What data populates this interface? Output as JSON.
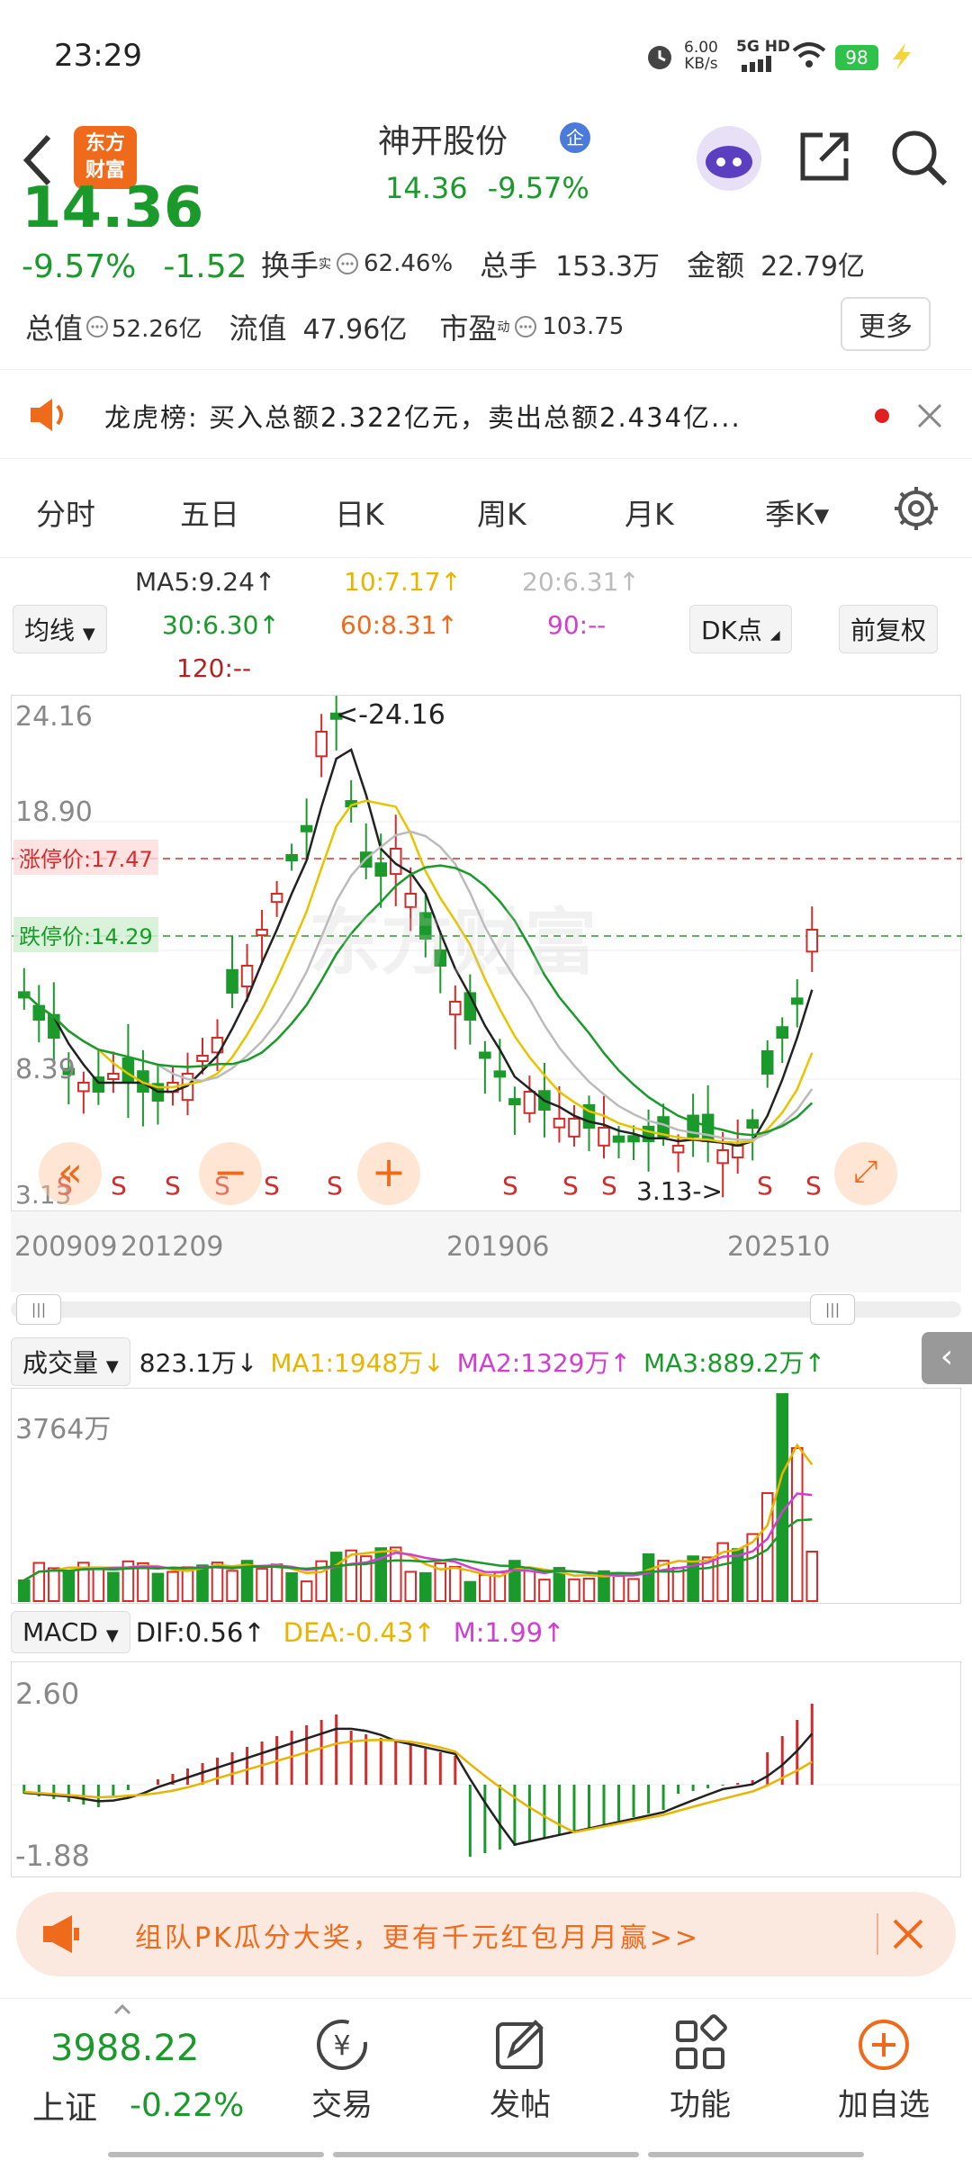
{
  "status_bar": {
    "time": "23:29",
    "net_speed_value": "6.00",
    "net_speed_unit": "KB/s",
    "network": "5G HD",
    "battery": "98"
  },
  "header": {
    "app_logo_line1": "东方",
    "app_logo_line2": "财富",
    "stock_name": "神开股份",
    "stock_badge": "企",
    "price": "14.36",
    "change_pct": "-9.57%"
  },
  "quote": {
    "big_price_partial": "14.36",
    "change_pct": "-9.57%",
    "change_amt": "-1.52",
    "turnover_label": "换手",
    "turnover_sup": "实",
    "turnover": "62.46%",
    "volume_label": "总手",
    "volume": "153.3万",
    "amount_label": "金额",
    "amount": "22.79亿",
    "mktcap_label": "总值",
    "mktcap": "52.26亿",
    "float_label": "流值",
    "float_cap": "47.96亿",
    "pe_label": "市盈",
    "pe_sup": "动",
    "pe": "103.75",
    "more_label": "更多"
  },
  "news": {
    "text": "龙虎榜: 买入总额2.322亿元，卖出总额2.434亿..."
  },
  "tabs": [
    "分时",
    "五日",
    "日K",
    "周K",
    "月K",
    "季K▾"
  ],
  "ma_legend": {
    "selector": "均线",
    "ma5": "MA5:9.24↑",
    "ma10": "10:7.17↑",
    "ma20": "20:6.31↑",
    "ma30": "30:6.30↑",
    "ma60": "60:8.31↑",
    "ma90": "90:--",
    "ma120": "120:--",
    "dk_label": "DK点",
    "adjust_label": "前复权"
  },
  "kline": {
    "y_labels": [
      "24.16",
      "18.90",
      "8.39",
      "3.13"
    ],
    "limit_up": "涨停价:17.47",
    "limit_down": "跌停价:14.29",
    "high_marker": "<-24.16",
    "low_marker": "3.13->",
    "x_labels": [
      "200909",
      "201209",
      "201906",
      "202510"
    ],
    "watermark": "东方财富",
    "s_marker": "S"
  },
  "volume": {
    "selector": "成交量",
    "value": "823.1万↓",
    "ma1": "MA1:1948万↓",
    "ma2": "MA2:1329万↑",
    "ma3": "MA3:889.2万↑",
    "max_label": "3764万"
  },
  "macd": {
    "selector": "MACD",
    "dif": "DIF:0.56↑",
    "dea": "DEA:-0.43↑",
    "m": "M:1.99↑",
    "max_label": "2.60",
    "min_label": "-1.88"
  },
  "ad": {
    "text": "组队PK瓜分大奖，更有千元红包月月赢>>"
  },
  "bottom_nav": {
    "index_value": "3988.22",
    "index_name": "上证",
    "index_change": "-0.22%",
    "trade": "交易",
    "post": "发帖",
    "functions": "功能",
    "add_watch": "加自选"
  },
  "colors": {
    "up": "#d42b2b",
    "down": "#1a9a2a",
    "accent": "#f06a1c"
  }
}
